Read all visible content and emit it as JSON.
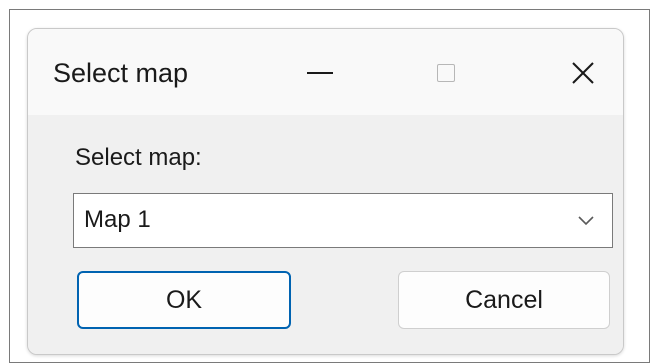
{
  "window": {
    "title": "Select map",
    "controls": {
      "minimize": "minimize-icon",
      "maximize": "maximize-icon",
      "close": "close-icon"
    }
  },
  "form": {
    "label": "Select map:",
    "selected_value": "Map 1",
    "dropdown_icon": "chevron-down-icon"
  },
  "buttons": {
    "ok_label": "OK",
    "cancel_label": "Cancel"
  },
  "colors": {
    "accent_border": "#0063b1",
    "dialog_background": "#f0f0f0",
    "titlebar_background": "#f9f9f9"
  }
}
